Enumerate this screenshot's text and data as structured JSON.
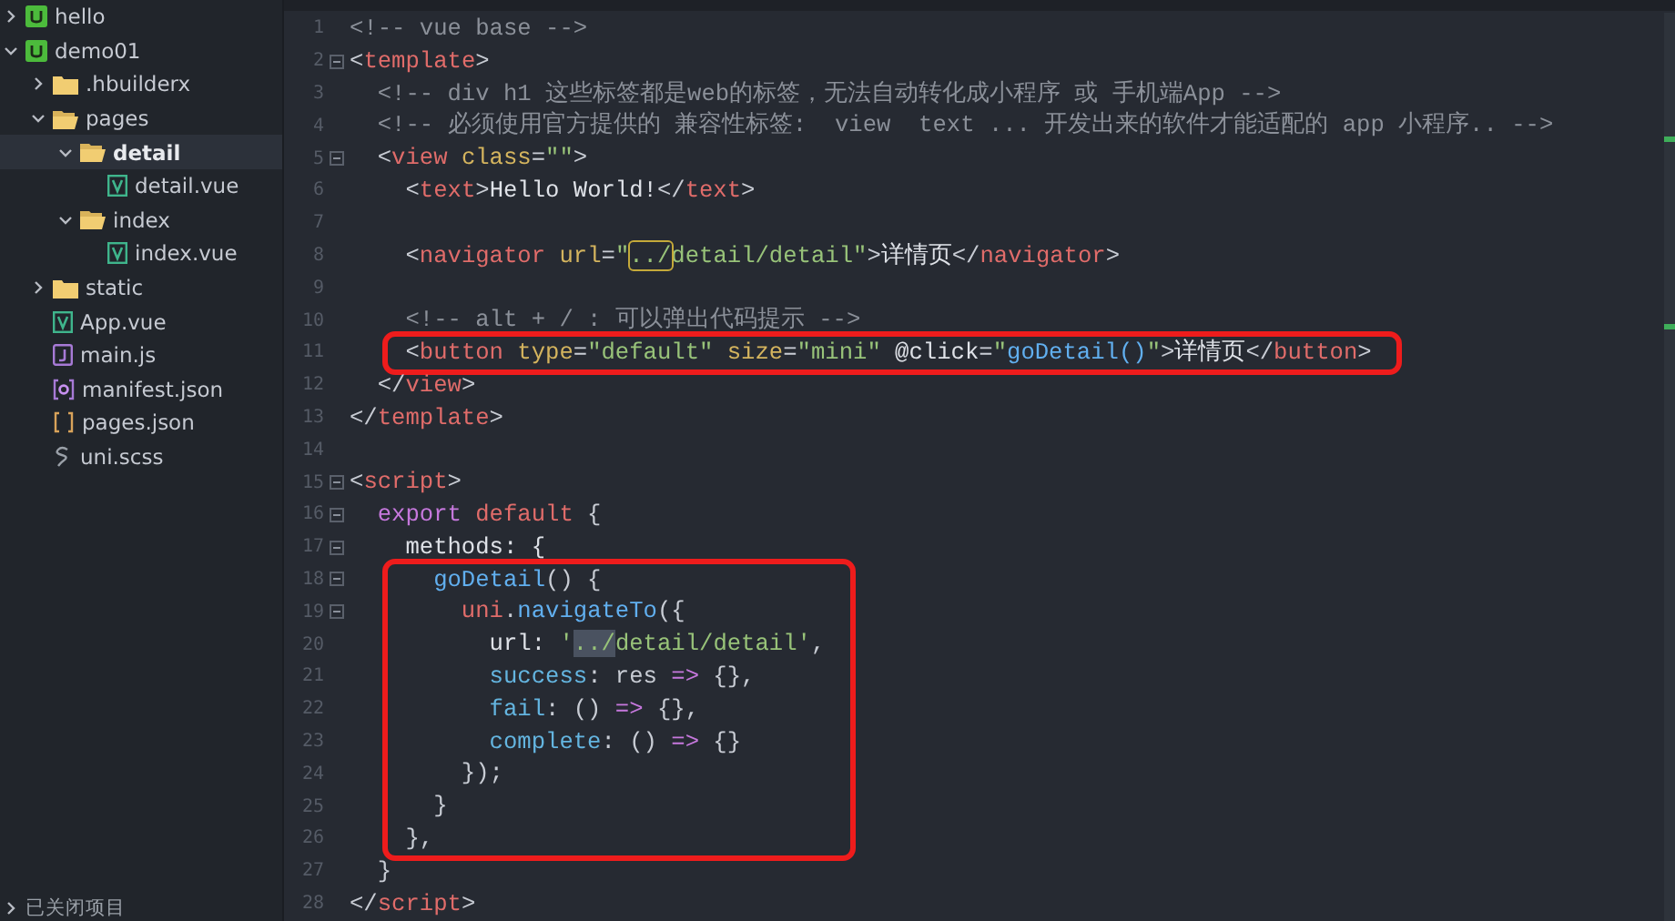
{
  "sidebar": {
    "tree": [
      {
        "label": "hello",
        "kind": "project",
        "expanded": false,
        "selected": false
      },
      {
        "label": "demo01",
        "kind": "project",
        "expanded": true,
        "selected": false,
        "children": [
          {
            "label": ".hbuilderx",
            "kind": "folder",
            "expanded": false,
            "selected": false
          },
          {
            "label": "pages",
            "kind": "folder",
            "expanded": true,
            "selected": false,
            "children": [
              {
                "label": "detail",
                "kind": "folder",
                "expanded": true,
                "selected": true,
                "children": [
                  {
                    "label": "detail.vue",
                    "kind": "vue",
                    "selected": false
                  }
                ]
              },
              {
                "label": "index",
                "kind": "folder",
                "expanded": true,
                "selected": false,
                "children": [
                  {
                    "label": "index.vue",
                    "kind": "vue",
                    "selected": false
                  }
                ]
              }
            ]
          },
          {
            "label": "static",
            "kind": "folder",
            "expanded": false,
            "selected": false
          },
          {
            "label": "App.vue",
            "kind": "vue",
            "selected": false
          },
          {
            "label": "main.js",
            "kind": "js",
            "selected": false
          },
          {
            "label": "manifest.json",
            "kind": "manifest",
            "selected": false
          },
          {
            "label": "pages.json",
            "kind": "json",
            "selected": false
          },
          {
            "label": "uni.scss",
            "kind": "scss",
            "selected": false
          }
        ]
      }
    ],
    "footer": {
      "label": "已关闭项目",
      "expanded": false
    }
  },
  "editor": {
    "blocks": [
      {
        "lines": [
          {
            "number": "1",
            "tokens": [
              {
                "text": "<!-- vue base -->",
                "kind": "comment"
              }
            ]
          },
          {
            "number": "2",
            "fold": true,
            "tokens": [
              {
                "text": "<",
                "kind": "punct"
              },
              {
                "text": "template",
                "kind": "tag"
              },
              {
                "text": ">",
                "kind": "punct"
              }
            ]
          },
          {
            "number": "3",
            "tokens": [
              {
                "text": "  <!-- div h1 这些标签都是web的标签，无法自动转化成小程序 或 手机端App -->",
                "kind": "comment"
              }
            ]
          },
          {
            "number": "4",
            "tokens": [
              {
                "text": "  <!-- 必须使用官方提供的 兼容性标签:  view  text ... 开发出来的软件才能适配的 app 小程序.. -->",
                "kind": "comment"
              }
            ]
          },
          {
            "number": "5",
            "fold": true,
            "tokens": [
              {
                "text": "  <",
                "kind": "punct"
              },
              {
                "text": "view",
                "kind": "tag"
              },
              {
                "text": " class",
                "kind": "attr"
              },
              {
                "text": "=",
                "kind": "punct"
              },
              {
                "text": "\"\"",
                "kind": "string"
              },
              {
                "text": ">",
                "kind": "punct"
              }
            ]
          },
          {
            "number": "6",
            "tokens": [
              {
                "text": "    <",
                "kind": "punct"
              },
              {
                "text": "text",
                "kind": "tag"
              },
              {
                "text": ">",
                "kind": "punct"
              },
              {
                "text": "Hello World!",
                "kind": "plain"
              },
              {
                "text": "</",
                "kind": "punct"
              },
              {
                "text": "text",
                "kind": "tag"
              },
              {
                "text": ">",
                "kind": "punct"
              }
            ]
          },
          {
            "number": "7"
          },
          {
            "number": "8",
            "tokens": [
              {
                "text": "    <",
                "kind": "punct"
              },
              {
                "text": "navigator",
                "kind": "tag"
              },
              {
                "text": " url",
                "kind": "attr"
              },
              {
                "text": "=",
                "kind": "punct"
              },
              {
                "text": "\"",
                "kind": "string"
              },
              {
                "text": "../",
                "kind": "match"
              },
              {
                "text": "detail/detail\"",
                "kind": "string"
              },
              {
                "text": ">",
                "kind": "punct"
              },
              {
                "text": "详情页",
                "kind": "plain"
              },
              {
                "text": "</",
                "kind": "punct"
              },
              {
                "text": "navigator",
                "kind": "tag"
              },
              {
                "text": ">",
                "kind": "punct"
              }
            ]
          },
          {
            "number": "9"
          },
          {
            "number": "10",
            "tokens": [
              {
                "text": "    <!-- alt + / : 可以弹出代码提示 -->",
                "kind": "comment"
              }
            ]
          }
        ]
      },
      {
        "boxed": true,
        "lines": [
          {
            "number": "11",
            "tokens": [
              {
                "text": "    <",
                "kind": "punct"
              },
              {
                "text": "button",
                "kind": "tag"
              },
              {
                "text": " type",
                "kind": "attr"
              },
              {
                "text": "=",
                "kind": "punct"
              },
              {
                "text": "\"default\"",
                "kind": "string"
              },
              {
                "text": " size",
                "kind": "attr"
              },
              {
                "text": "=",
                "kind": "punct"
              },
              {
                "text": "\"mini\"",
                "kind": "string"
              },
              {
                "text": " @click",
                "kind": "plain"
              },
              {
                "text": "=",
                "kind": "punct"
              },
              {
                "text": "\"",
                "kind": "string"
              },
              {
                "text": "goDetail()",
                "kind": "func"
              },
              {
                "text": "\"",
                "kind": "string"
              },
              {
                "text": ">",
                "kind": "punct"
              },
              {
                "text": "详情页",
                "kind": "plain"
              },
              {
                "text": "</",
                "kind": "punct"
              },
              {
                "text": "button",
                "kind": "tag"
              },
              {
                "text": ">",
                "kind": "punct"
              }
            ]
          }
        ]
      },
      {
        "lines": [
          {
            "number": "12",
            "tokens": [
              {
                "text": "  </",
                "kind": "punct"
              },
              {
                "text": "view",
                "kind": "tag"
              },
              {
                "text": ">",
                "kind": "punct"
              }
            ]
          },
          {
            "number": "13",
            "tokens": [
              {
                "text": "</",
                "kind": "punct"
              },
              {
                "text": "template",
                "kind": "tag"
              },
              {
                "text": ">",
                "kind": "punct"
              }
            ]
          },
          {
            "number": "14"
          },
          {
            "number": "15",
            "fold": true,
            "tokens": [
              {
                "text": "<",
                "kind": "punct"
              },
              {
                "text": "script",
                "kind": "tag"
              },
              {
                "text": ">",
                "kind": "punct"
              }
            ]
          },
          {
            "number": "16",
            "fold": true,
            "tokens": [
              {
                "text": "  export",
                "kind": "keyword"
              },
              {
                "text": " default",
                "kind": "tag"
              },
              {
                "text": " {",
                "kind": "punct"
              }
            ]
          },
          {
            "number": "17",
            "fold": true,
            "tokens": [
              {
                "text": "    methods: {",
                "kind": "plain"
              }
            ]
          }
        ]
      },
      {
        "boxed": true,
        "lines": [
          {
            "number": "18",
            "fold": true,
            "tokens": [
              {
                "text": "      goDetail",
                "kind": "func"
              },
              {
                "text": "() {",
                "kind": "punct"
              }
            ]
          },
          {
            "number": "19",
            "fold": true,
            "tokens": [
              {
                "text": "        uni",
                "kind": "tag"
              },
              {
                "text": ".",
                "kind": "punct"
              },
              {
                "text": "navigateTo",
                "kind": "func"
              },
              {
                "text": "({",
                "kind": "punct"
              }
            ]
          },
          {
            "number": "20",
            "tokens": [
              {
                "text": "          url: ",
                "kind": "plain"
              },
              {
                "text": "'",
                "kind": "string"
              },
              {
                "text": "../",
                "kind": "selection"
              },
              {
                "text": "detail/detail'",
                "kind": "string"
              },
              {
                "text": ",",
                "kind": "punct"
              }
            ]
          },
          {
            "number": "21",
            "tokens": [
              {
                "text": "          success",
                "kind": "prop"
              },
              {
                "text": ": res ",
                "kind": "punct"
              },
              {
                "text": "=>",
                "kind": "keyword"
              },
              {
                "text": " {},",
                "kind": "punct"
              }
            ]
          },
          {
            "number": "22",
            "tokens": [
              {
                "text": "          fail",
                "kind": "prop"
              },
              {
                "text": ": () ",
                "kind": "punct"
              },
              {
                "text": "=>",
                "kind": "keyword"
              },
              {
                "text": " {},",
                "kind": "punct"
              }
            ]
          },
          {
            "number": "23",
            "tokens": [
              {
                "text": "          complete",
                "kind": "prop"
              },
              {
                "text": ": () ",
                "kind": "punct"
              },
              {
                "text": "=>",
                "kind": "keyword"
              },
              {
                "text": " {}",
                "kind": "punct"
              }
            ]
          },
          {
            "number": "24",
            "tokens": [
              {
                "text": "        });",
                "kind": "punct"
              }
            ]
          },
          {
            "number": "25",
            "tokens": [
              {
                "text": "      }",
                "kind": "punct"
              }
            ]
          },
          {
            "number": "26",
            "tokens": [
              {
                "text": "    },",
                "kind": "punct"
              }
            ]
          }
        ]
      },
      {
        "lines": [
          {
            "number": "27",
            "tokens": [
              {
                "text": "  }",
                "kind": "punct"
              }
            ]
          },
          {
            "number": "28",
            "tokens": [
              {
                "text": "</",
                "kind": "punct"
              },
              {
                "text": "script",
                "kind": "tag"
              },
              {
                "text": ">",
                "kind": "punct"
              }
            ]
          }
        ]
      }
    ]
  }
}
